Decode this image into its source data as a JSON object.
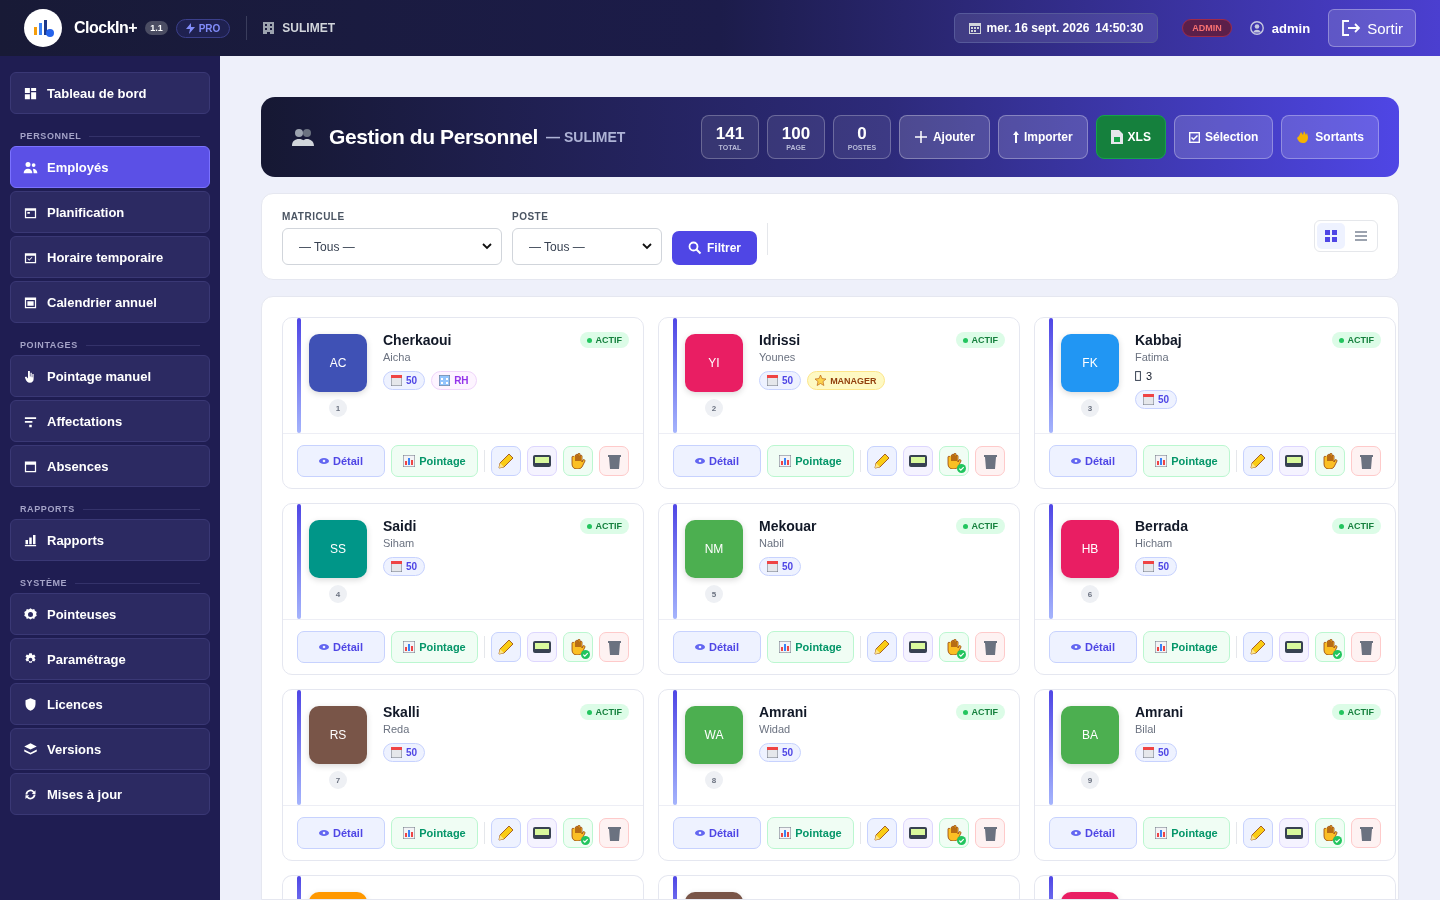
{
  "topbar": {
    "app_name": "ClockIn+",
    "version": "1.1",
    "plan": "PRO",
    "company": "SULIMET",
    "datetime_date": "mer. 16 sept. 2026",
    "datetime_time": "14:50:30",
    "role": "ADMIN",
    "user": "admin",
    "logout": "Sortir"
  },
  "sidebar": {
    "sections": [
      {
        "items": [
          {
            "label": "Tableau de bord",
            "selected": false
          }
        ]
      },
      {
        "title": "PERSONNEL",
        "items": [
          {
            "label": "Employés",
            "selected": true
          },
          {
            "label": "Planification",
            "selected": false
          },
          {
            "label": "Horaire temporaire",
            "selected": false
          },
          {
            "label": "Calendrier annuel",
            "selected": false
          }
        ]
      },
      {
        "title": "POINTAGES",
        "items": [
          {
            "label": "Pointage manuel",
            "selected": false
          },
          {
            "label": "Affectations",
            "selected": false
          },
          {
            "label": "Absences",
            "selected": false
          }
        ]
      },
      {
        "title": "RAPPORTS",
        "items": [
          {
            "label": "Rapports",
            "selected": false
          }
        ]
      },
      {
        "title": "SYSTÈME",
        "items": [
          {
            "label": "Pointeuses",
            "selected": false
          },
          {
            "label": "Paramétrage",
            "selected": false
          },
          {
            "label": "Licences",
            "selected": false
          },
          {
            "label": "Versions",
            "selected": false
          },
          {
            "label": "Mises à jour",
            "selected": false
          }
        ]
      }
    ]
  },
  "banner": {
    "title": "Gestion du Personnel",
    "subtitle": "— SULIMET",
    "stats": [
      {
        "value": "141",
        "label": "TOTAL"
      },
      {
        "value": "100",
        "label": "PAGE"
      },
      {
        "value": "0",
        "label": "POSTES"
      }
    ],
    "buttons": [
      {
        "label": "Ajouter",
        "kind": "add"
      },
      {
        "label": "Importer",
        "kind": "import"
      },
      {
        "label": "XLS",
        "kind": "xls"
      },
      {
        "label": "Sélection",
        "kind": "select"
      },
      {
        "label": "Sortants",
        "kind": "leaving"
      }
    ]
  },
  "filters": {
    "fields": [
      {
        "label": "MATRICULE",
        "value": "— Tous —"
      },
      {
        "label": "POSTE",
        "value": "— Tous —"
      }
    ],
    "submit": "Filtrer",
    "views": [
      {
        "kind": "grid",
        "selected": true
      },
      {
        "kind": "list",
        "selected": false
      }
    ]
  },
  "employees": [
    {
      "initials": "AC",
      "color": "#3f51b5",
      "last_name": "Cherkaoui",
      "first_name": "Aicha",
      "status": "ACTIF",
      "number": "1",
      "tags": [
        {
          "kind": "dept",
          "label": "50"
        },
        {
          "kind": "rh",
          "label": "RH"
        }
      ],
      "pointed": false,
      "detail": "Détail",
      "pointage": "Pointage"
    },
    {
      "initials": "YI",
      "color": "#e91e63",
      "last_name": "Idrissi",
      "first_name": "Younes",
      "status": "ACTIF",
      "number": "2",
      "tags": [
        {
          "kind": "dept",
          "label": "50"
        },
        {
          "kind": "manager",
          "label": "MANAGER"
        }
      ],
      "pointed": true,
      "detail": "Détail",
      "pointage": "Pointage"
    },
    {
      "initials": "FK",
      "color": "#2196f3",
      "last_name": "Kabbaj",
      "first_name": "Fatima",
      "status": "ACTIF",
      "number": "3",
      "extra": "3",
      "tags": [
        {
          "kind": "dept",
          "label": "50"
        }
      ],
      "pointed": false,
      "detail": "Détail",
      "pointage": "Pointage"
    },
    {
      "initials": "SS",
      "color": "#009688",
      "last_name": "Saidi",
      "first_name": "Siham",
      "status": "ACTIF",
      "number": "4",
      "tags": [
        {
          "kind": "dept",
          "label": "50"
        }
      ],
      "pointed": true,
      "detail": "Détail",
      "pointage": "Pointage"
    },
    {
      "initials": "NM",
      "color": "#4caf50",
      "last_name": "Mekouar",
      "first_name": "Nabil",
      "status": "ACTIF",
      "number": "5",
      "tags": [
        {
          "kind": "dept",
          "label": "50"
        }
      ],
      "pointed": true,
      "detail": "Détail",
      "pointage": "Pointage"
    },
    {
      "initials": "HB",
      "color": "#e91e63",
      "last_name": "Berrada",
      "first_name": "Hicham",
      "status": "ACTIF",
      "number": "6",
      "tags": [
        {
          "kind": "dept",
          "label": "50"
        }
      ],
      "pointed": true,
      "detail": "Détail",
      "pointage": "Pointage"
    },
    {
      "initials": "RS",
      "color": "#795548",
      "last_name": "Skalli",
      "first_name": "Reda",
      "status": "ACTIF",
      "number": "7",
      "tags": [
        {
          "kind": "dept",
          "label": "50"
        }
      ],
      "pointed": true,
      "detail": "Détail",
      "pointage": "Pointage"
    },
    {
      "initials": "WA",
      "color": "#4caf50",
      "last_name": "Amrani",
      "first_name": "Widad",
      "status": "ACTIF",
      "number": "8",
      "tags": [
        {
          "kind": "dept",
          "label": "50"
        }
      ],
      "pointed": true,
      "detail": "Détail",
      "pointage": "Pointage"
    },
    {
      "initials": "BA",
      "color": "#4caf50",
      "last_name": "Amrani",
      "first_name": "Bilal",
      "status": "ACTIF",
      "number": "9",
      "tags": [
        {
          "kind": "dept",
          "label": "50"
        }
      ],
      "pointed": true,
      "detail": "Détail",
      "pointage": "Pointage"
    }
  ],
  "partial_employees": [
    {
      "color": "#ff9800"
    },
    {
      "color": "#795548"
    },
    {
      "color": "#e91e63"
    }
  ]
}
